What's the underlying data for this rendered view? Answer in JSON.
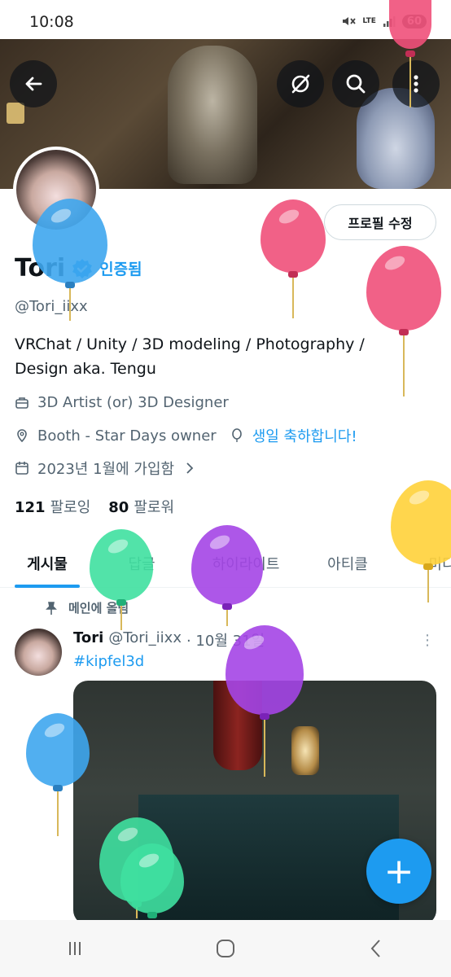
{
  "status_bar": {
    "time": "10:08",
    "network": "LTE",
    "battery": "60"
  },
  "profile": {
    "edit_button": "프로필 수정",
    "name": "Tori",
    "verified_label": "인증됨",
    "handle": "@Tori_iixx",
    "bio_line1": "VRChat / Unity / 3D modeling / Photography /",
    "bio_line2": "Design aka. Tengu",
    "job": "3D Artist (or) 3D Designer",
    "location": "Booth - Star Days owner",
    "birthday": "생일 축하합니다!",
    "joined": "2023년 1월에 가입함",
    "following_count": "121",
    "following_label": "팔로잉",
    "followers_count": "80",
    "followers_label": "팔로워"
  },
  "tabs": [
    "게시물",
    "답글",
    "하이라이트",
    "아티클",
    "미디어"
  ],
  "post": {
    "pinned_label": "메인에 올림",
    "author": "Tori",
    "handle": "@Tori_iixx",
    "date": "· 10월 31일",
    "hashtag": "#kipfel3d",
    "more": "⋮"
  },
  "fab_label": "+",
  "colors": {
    "accent": "#1d9bf0",
    "text_primary": "#0f1419",
    "text_secondary": "#536471",
    "balloon_blue": "#3ea6ee",
    "balloon_pink": "#f0507a",
    "balloon_purple": "#a445e6",
    "balloon_green": "#3fe0a0",
    "balloon_yellow": "#ffd23a"
  }
}
